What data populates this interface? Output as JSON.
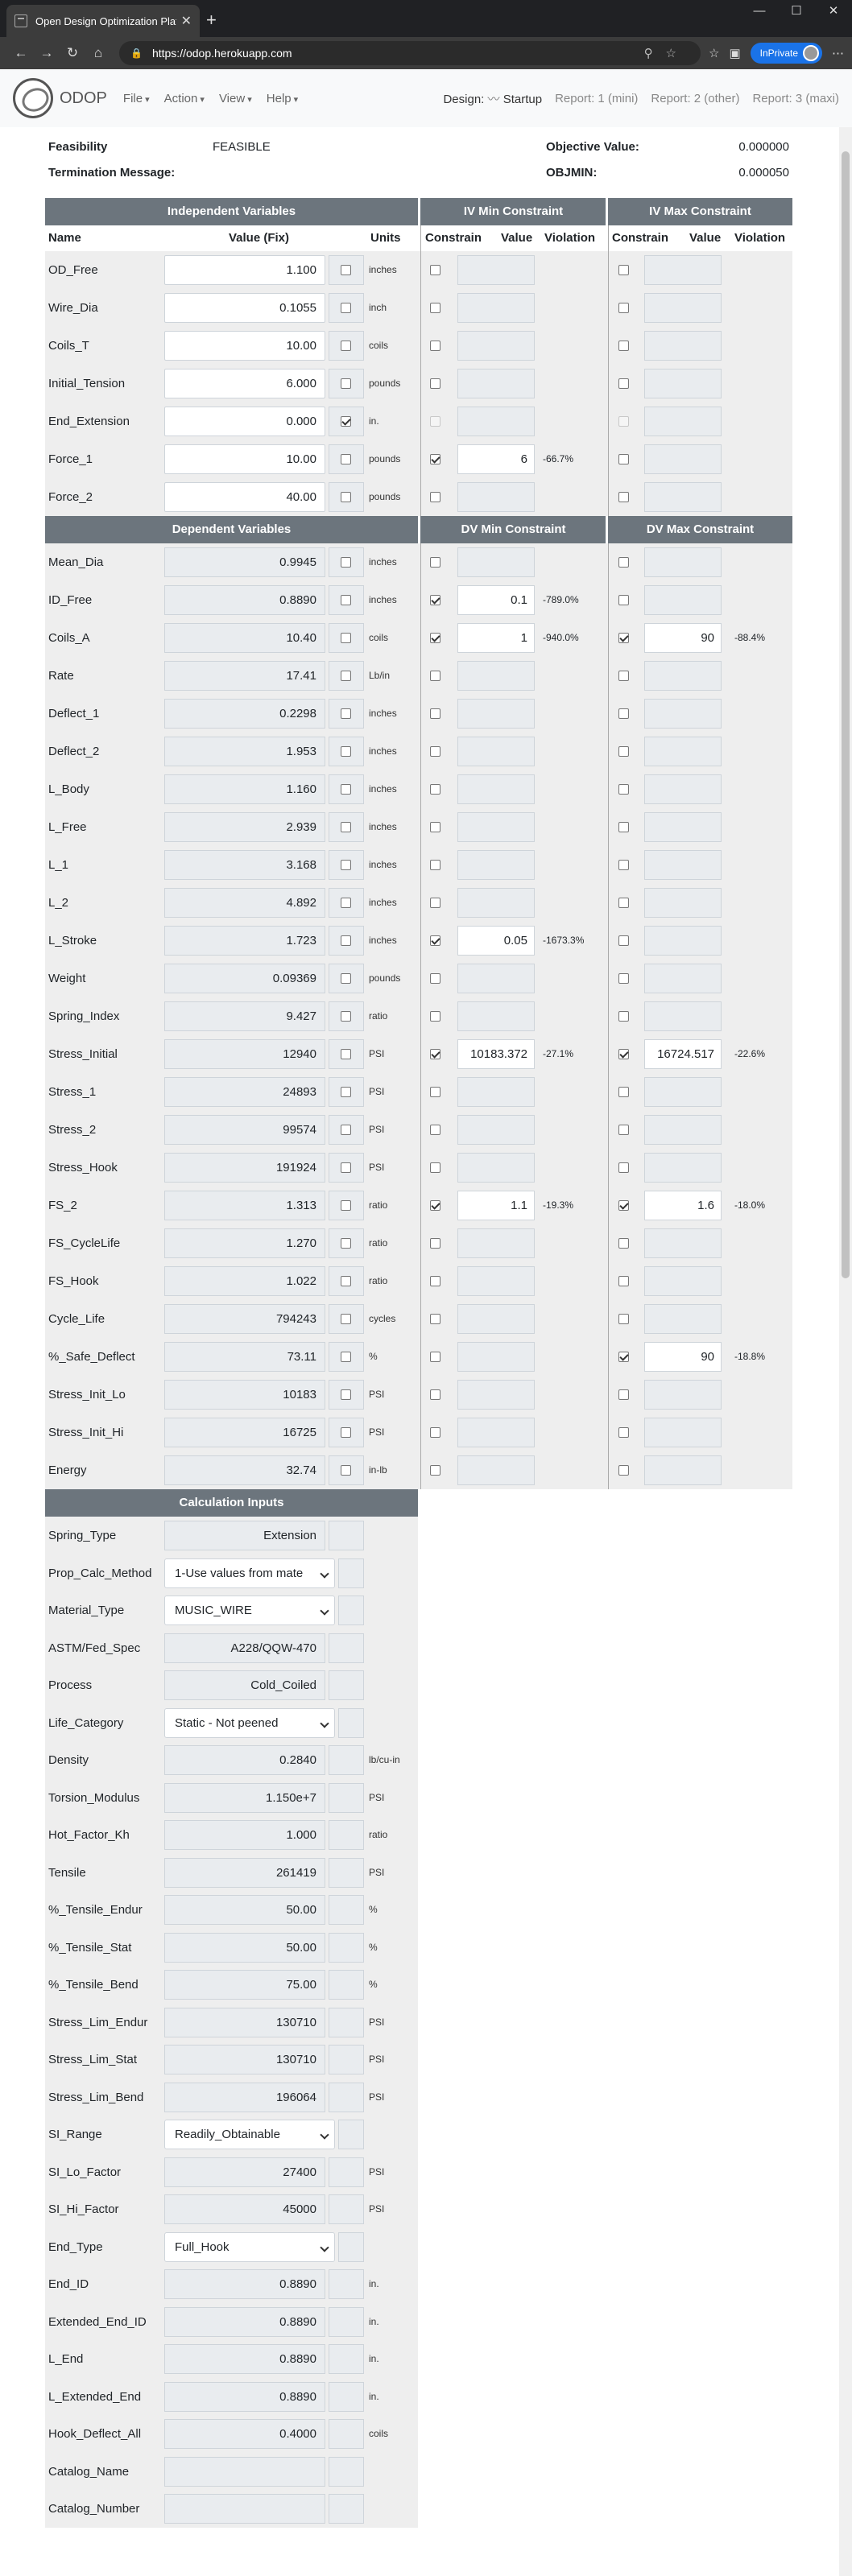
{
  "browser": {
    "tab_title": "Open Design Optimization Platf",
    "url": "https://odop.herokuapp.com",
    "inprivate_label": "InPrivate"
  },
  "app": {
    "brand": "ODOP",
    "menus": [
      "File",
      "Action",
      "View",
      "Help"
    ],
    "design_label": "Design:",
    "design_name": "Startup",
    "reports": [
      "Report: 1 (mini)",
      "Report: 2 (other)",
      "Report: 3 (maxi)"
    ]
  },
  "status": {
    "feasibility_label": "Feasibility",
    "feasibility_value": "FEASIBLE",
    "termination_label": "Termination Message:",
    "objective_label": "Objective Value:",
    "objective_value": "0.000000",
    "objmin_label": "OBJMIN:",
    "objmin_value": "0.000050"
  },
  "headers": {
    "iv": "Independent Variables",
    "iv_min": "IV Min Constraint",
    "iv_max": "IV Max Constraint",
    "dv": "Dependent Variables",
    "dv_min": "DV Min Constraint",
    "dv_max": "DV Max Constraint",
    "calc": "Calculation Inputs",
    "name": "Name",
    "value_fix": "Value (Fix)",
    "units": "Units",
    "constrain": "Constrain",
    "value": "Value",
    "violation": "Violation"
  },
  "iv_rows": [
    {
      "name": "OD_Free",
      "value": "1.100",
      "fix": false,
      "units": "inches",
      "min_on": false,
      "min_val": "",
      "min_viol": "",
      "max_on": false,
      "max_val": "",
      "max_viol": ""
    },
    {
      "name": "Wire_Dia",
      "value": "0.1055",
      "fix": false,
      "units": "inch",
      "min_on": false,
      "min_val": "",
      "min_viol": "",
      "max_on": false,
      "max_val": "",
      "max_viol": ""
    },
    {
      "name": "Coils_T",
      "value": "10.00",
      "fix": false,
      "units": "coils",
      "min_on": false,
      "min_val": "",
      "min_viol": "",
      "max_on": false,
      "max_val": "",
      "max_viol": ""
    },
    {
      "name": "Initial_Tension",
      "value": "6.000",
      "fix": false,
      "units": "pounds",
      "min_on": false,
      "min_val": "",
      "min_viol": "",
      "max_on": false,
      "max_val": "",
      "max_viol": ""
    },
    {
      "name": "End_Extension",
      "value": "0.000",
      "fix": true,
      "units": "in.",
      "min_on": false,
      "min_val": "",
      "min_viol": "",
      "max_on": false,
      "max_val": "",
      "max_viol": "",
      "disabled": true
    },
    {
      "name": "Force_1",
      "value": "10.00",
      "fix": false,
      "units": "pounds",
      "min_on": true,
      "min_val": "6",
      "min_viol": "-66.7%",
      "max_on": false,
      "max_val": "",
      "max_viol": ""
    },
    {
      "name": "Force_2",
      "value": "40.00",
      "fix": false,
      "units": "pounds",
      "min_on": false,
      "min_val": "",
      "min_viol": "",
      "max_on": false,
      "max_val": "",
      "max_viol": ""
    }
  ],
  "dv_rows": [
    {
      "name": "Mean_Dia",
      "value": "0.9945",
      "units": "inches",
      "min_on": false,
      "min_val": "",
      "min_viol": "",
      "max_on": false,
      "max_val": "",
      "max_viol": ""
    },
    {
      "name": "ID_Free",
      "value": "0.8890",
      "units": "inches",
      "min_on": true,
      "min_val": "0.1",
      "min_viol": "-789.0%",
      "max_on": false,
      "max_val": "",
      "max_viol": ""
    },
    {
      "name": "Coils_A",
      "value": "10.40",
      "units": "coils",
      "min_on": true,
      "min_val": "1",
      "min_viol": "-940.0%",
      "max_on": true,
      "max_val": "90",
      "max_viol": "-88.4%"
    },
    {
      "name": "Rate",
      "value": "17.41",
      "units": "Lb/in",
      "min_on": false,
      "min_val": "",
      "min_viol": "",
      "max_on": false,
      "max_val": "",
      "max_viol": ""
    },
    {
      "name": "Deflect_1",
      "value": "0.2298",
      "units": "inches",
      "min_on": false,
      "min_val": "",
      "min_viol": "",
      "max_on": false,
      "max_val": "",
      "max_viol": ""
    },
    {
      "name": "Deflect_2",
      "value": "1.953",
      "units": "inches",
      "min_on": false,
      "min_val": "",
      "min_viol": "",
      "max_on": false,
      "max_val": "",
      "max_viol": ""
    },
    {
      "name": "L_Body",
      "value": "1.160",
      "units": "inches",
      "min_on": false,
      "min_val": "",
      "min_viol": "",
      "max_on": false,
      "max_val": "",
      "max_viol": ""
    },
    {
      "name": "L_Free",
      "value": "2.939",
      "units": "inches",
      "min_on": false,
      "min_val": "",
      "min_viol": "",
      "max_on": false,
      "max_val": "",
      "max_viol": ""
    },
    {
      "name": "L_1",
      "value": "3.168",
      "units": "inches",
      "min_on": false,
      "min_val": "",
      "min_viol": "",
      "max_on": false,
      "max_val": "",
      "max_viol": ""
    },
    {
      "name": "L_2",
      "value": "4.892",
      "units": "inches",
      "min_on": false,
      "min_val": "",
      "min_viol": "",
      "max_on": false,
      "max_val": "",
      "max_viol": ""
    },
    {
      "name": "L_Stroke",
      "value": "1.723",
      "units": "inches",
      "min_on": true,
      "min_val": "0.05",
      "min_viol": "-1673.3%",
      "max_on": false,
      "max_val": "",
      "max_viol": ""
    },
    {
      "name": "Weight",
      "value": "0.09369",
      "units": "pounds",
      "min_on": false,
      "min_val": "",
      "min_viol": "",
      "max_on": false,
      "max_val": "",
      "max_viol": ""
    },
    {
      "name": "Spring_Index",
      "value": "9.427",
      "units": "ratio",
      "min_on": false,
      "min_val": "",
      "min_viol": "",
      "max_on": false,
      "max_val": "",
      "max_viol": ""
    },
    {
      "name": "Stress_Initial",
      "value": "12940",
      "units": "PSI",
      "min_on": true,
      "min_val": "10183.372",
      "min_viol": "-27.1%",
      "max_on": true,
      "max_val": "16724.517",
      "max_viol": "-22.6%"
    },
    {
      "name": "Stress_1",
      "value": "24893",
      "units": "PSI",
      "min_on": false,
      "min_val": "",
      "min_viol": "",
      "max_on": false,
      "max_val": "",
      "max_viol": ""
    },
    {
      "name": "Stress_2",
      "value": "99574",
      "units": "PSI",
      "min_on": false,
      "min_val": "",
      "min_viol": "",
      "max_on": false,
      "max_val": "",
      "max_viol": ""
    },
    {
      "name": "Stress_Hook",
      "value": "191924",
      "units": "PSI",
      "min_on": false,
      "min_val": "",
      "min_viol": "",
      "max_on": false,
      "max_val": "",
      "max_viol": ""
    },
    {
      "name": "FS_2",
      "value": "1.313",
      "units": "ratio",
      "min_on": true,
      "min_val": "1.1",
      "min_viol": "-19.3%",
      "max_on": true,
      "max_val": "1.6",
      "max_viol": "-18.0%"
    },
    {
      "name": "FS_CycleLife",
      "value": "1.270",
      "units": "ratio",
      "min_on": false,
      "min_val": "",
      "min_viol": "",
      "max_on": false,
      "max_val": "",
      "max_viol": ""
    },
    {
      "name": "FS_Hook",
      "value": "1.022",
      "units": "ratio",
      "min_on": false,
      "min_val": "",
      "min_viol": "",
      "max_on": false,
      "max_val": "",
      "max_viol": ""
    },
    {
      "name": "Cycle_Life",
      "value": "794243",
      "units": "cycles",
      "min_on": false,
      "min_val": "",
      "min_viol": "",
      "max_on": false,
      "max_val": "",
      "max_viol": ""
    },
    {
      "name": "%_Safe_Deflect",
      "value": "73.11",
      "units": "%",
      "min_on": false,
      "min_val": "",
      "min_viol": "",
      "max_on": true,
      "max_val": "90",
      "max_viol": "-18.8%"
    },
    {
      "name": "Stress_Init_Lo",
      "value": "10183",
      "units": "PSI",
      "min_on": false,
      "min_val": "",
      "min_viol": "",
      "max_on": false,
      "max_val": "",
      "max_viol": ""
    },
    {
      "name": "Stress_Init_Hi",
      "value": "16725",
      "units": "PSI",
      "min_on": false,
      "min_val": "",
      "min_viol": "",
      "max_on": false,
      "max_val": "",
      "max_viol": ""
    },
    {
      "name": "Energy",
      "value": "32.74",
      "units": "in-lb",
      "min_on": false,
      "min_val": "",
      "min_viol": "",
      "max_on": false,
      "max_val": "",
      "max_viol": ""
    }
  ],
  "calc_rows": [
    {
      "name": "Spring_Type",
      "value": "Extension",
      "units": "",
      "kind": "text"
    },
    {
      "name": "Prop_Calc_Method",
      "value": "1-Use values from mate",
      "units": "",
      "kind": "select"
    },
    {
      "name": "Material_Type",
      "value": "MUSIC_WIRE",
      "units": "",
      "kind": "select"
    },
    {
      "name": "ASTM/Fed_Spec",
      "value": "A228/QQW-470",
      "units": "",
      "kind": "text"
    },
    {
      "name": "Process",
      "value": "Cold_Coiled",
      "units": "",
      "kind": "text"
    },
    {
      "name": "Life_Category",
      "value": "Static - Not peened",
      "units": "",
      "kind": "select"
    },
    {
      "name": "Density",
      "value": "0.2840",
      "units": "lb/cu-in",
      "kind": "text"
    },
    {
      "name": "Torsion_Modulus",
      "value": "1.150e+7",
      "units": "PSI",
      "kind": "text"
    },
    {
      "name": "Hot_Factor_Kh",
      "value": "1.000",
      "units": "ratio",
      "kind": "text"
    },
    {
      "name": "Tensile",
      "value": "261419",
      "units": "PSI",
      "kind": "text"
    },
    {
      "name": "%_Tensile_Endur",
      "value": "50.00",
      "units": "%",
      "kind": "text"
    },
    {
      "name": "%_Tensile_Stat",
      "value": "50.00",
      "units": "%",
      "kind": "text"
    },
    {
      "name": "%_Tensile_Bend",
      "value": "75.00",
      "units": "%",
      "kind": "text"
    },
    {
      "name": "Stress_Lim_Endur",
      "value": "130710",
      "units": "PSI",
      "kind": "text"
    },
    {
      "name": "Stress_Lim_Stat",
      "value": "130710",
      "units": "PSI",
      "kind": "text"
    },
    {
      "name": "Stress_Lim_Bend",
      "value": "196064",
      "units": "PSI",
      "kind": "text"
    },
    {
      "name": "SI_Range",
      "value": "Readily_Obtainable",
      "units": "",
      "kind": "select"
    },
    {
      "name": "SI_Lo_Factor",
      "value": "27400",
      "units": "PSI",
      "kind": "text"
    },
    {
      "name": "SI_Hi_Factor",
      "value": "45000",
      "units": "PSI",
      "kind": "text"
    },
    {
      "name": "End_Type",
      "value": "Full_Hook",
      "units": "",
      "kind": "select"
    },
    {
      "name": "End_ID",
      "value": "0.8890",
      "units": "in.",
      "kind": "text"
    },
    {
      "name": "Extended_End_ID",
      "value": "0.8890",
      "units": "in.",
      "kind": "text"
    },
    {
      "name": "L_End",
      "value": "0.8890",
      "units": "in.",
      "kind": "text"
    },
    {
      "name": "L_Extended_End",
      "value": "0.8890",
      "units": "in.",
      "kind": "text"
    },
    {
      "name": "Hook_Deflect_All",
      "value": "0.4000",
      "units": "coils",
      "kind": "text"
    },
    {
      "name": "Catalog_Name",
      "value": "",
      "units": "",
      "kind": "text"
    },
    {
      "name": "Catalog_Number",
      "value": "",
      "units": "",
      "kind": "text"
    }
  ]
}
